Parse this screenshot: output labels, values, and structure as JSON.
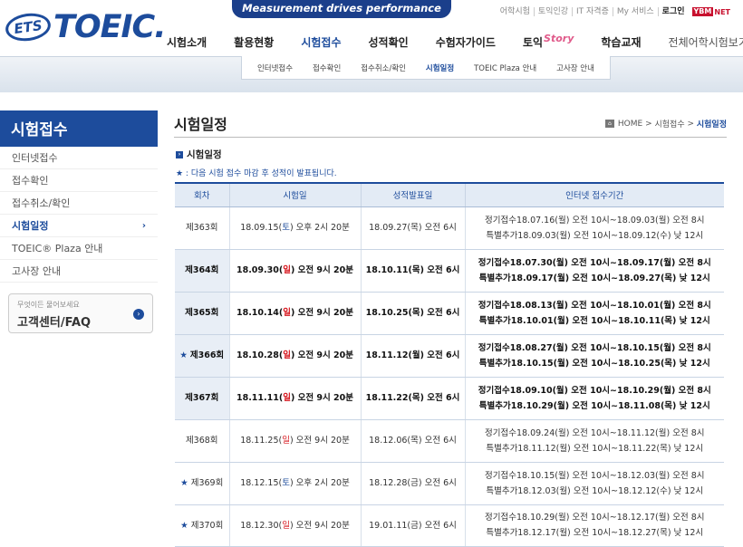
{
  "header": {
    "logo_ets": "ETS",
    "logo_toeic": "TOEIC.",
    "slogan": "Measurement drives performance",
    "util": [
      "어학시험",
      "토익인강",
      "IT 자격증",
      "My 서비스",
      "로그인"
    ],
    "ybm_logo": "YBM",
    "ybm_net": "NET",
    "gnb": [
      "시험소개",
      "활용현황",
      "시험접수",
      "성적확인",
      "수험자가이드",
      "토익",
      "학습교재",
      "전체어학시험보기"
    ],
    "gnb_story": "Story"
  },
  "submenu": [
    "인터넷접수",
    "접수확인",
    "접수취소/확인",
    "시험일정",
    "TOEIC Plaza 안내",
    "고사장 안내"
  ],
  "sidebar": {
    "title": "시험접수",
    "items": [
      "인터넷접수",
      "접수확인",
      "접수취소/확인",
      "시험일정",
      "TOEIC® Plaza 안내",
      "고사장 안내"
    ],
    "chevron": "›",
    "faq_small": "무엇이든 물어보세요",
    "faq_big": "고객센터/FAQ"
  },
  "content": {
    "title": "시험일정",
    "breadcrumb": [
      "HOME",
      "시험접수",
      "시험일정"
    ],
    "section_title": "시험일정",
    "note": "★ : 다음 시험 접수 마감 후 성적이 발표됩니다.",
    "columns": [
      "회차",
      "시험일",
      "성적발표일",
      "인터넷 접수기간"
    ]
  },
  "schedule": [
    {
      "star": false,
      "bold": false,
      "round": "제363회",
      "date_pre": "18.09.15(",
      "day": "토",
      "day_color": "blue",
      "date_post": ") 오후 2시 20분",
      "result": "18.09.27(목) 오전 6시",
      "period1": "정기접수18.07.16(월) 오전 10시~18.09.03(월) 오전 8시",
      "period2": "특별추가18.09.03(월) 오전 10시~18.09.12(수) 낮 12시"
    },
    {
      "star": false,
      "bold": true,
      "round": "제364회",
      "date_pre": "18.09.30(",
      "day": "일",
      "day_color": "red",
      "date_post": ") 오전 9시 20분",
      "result": "18.10.11(목) 오전 6시",
      "period1": "정기접수18.07.30(월) 오전 10시~18.09.17(월) 오전 8시",
      "period2": "특별추가18.09.17(월) 오전 10시~18.09.27(목) 낮 12시"
    },
    {
      "star": false,
      "bold": true,
      "round": "제365회",
      "date_pre": "18.10.14(",
      "day": "일",
      "day_color": "red",
      "date_post": ") 오전 9시 20분",
      "result": "18.10.25(목) 오전 6시",
      "period1": "정기접수18.08.13(월) 오전 10시~18.10.01(월) 오전 8시",
      "period2": "특별추가18.10.01(월) 오전 10시~18.10.11(목) 낮 12시"
    },
    {
      "star": true,
      "bold": true,
      "round": "제366회",
      "date_pre": "18.10.28(",
      "day": "일",
      "day_color": "red",
      "date_post": ") 오전 9시 20분",
      "result": "18.11.12(월) 오전 6시",
      "period1": "정기접수18.08.27(월) 오전 10시~18.10.15(월) 오전 8시",
      "period2": "특별추가18.10.15(월) 오전 10시~18.10.25(목) 낮 12시"
    },
    {
      "star": false,
      "bold": true,
      "round": "제367회",
      "date_pre": "18.11.11(",
      "day": "일",
      "day_color": "red",
      "date_post": ") 오전 9시 20분",
      "result": "18.11.22(목) 오전 6시",
      "period1": "정기접수18.09.10(월) 오전 10시~18.10.29(월) 오전 8시",
      "period2": "특별추가18.10.29(월) 오전 10시~18.11.08(목) 낮 12시"
    },
    {
      "star": false,
      "bold": false,
      "round": "제368회",
      "date_pre": "18.11.25(",
      "day": "일",
      "day_color": "red",
      "date_post": ") 오전 9시 20분",
      "result": "18.12.06(목) 오전 6시",
      "period1": "정기접수18.09.24(월) 오전 10시~18.11.12(월) 오전 8시",
      "period2": "특별추가18.11.12(월) 오전 10시~18.11.22(목) 낮 12시"
    },
    {
      "star": true,
      "bold": false,
      "round": "제369회",
      "date_pre": "18.12.15(",
      "day": "토",
      "day_color": "blue",
      "date_post": ") 오후 2시 20분",
      "result": "18.12.28(금) 오전 6시",
      "period1": "정기접수18.10.15(월) 오전 10시~18.12.03(월) 오전 8시",
      "period2": "특별추가18.12.03(월) 오전 10시~18.12.12(수) 낮 12시"
    },
    {
      "star": true,
      "bold": false,
      "round": "제370회",
      "date_pre": "18.12.30(",
      "day": "일",
      "day_color": "red",
      "date_post": ") 오전 9시 20분",
      "result": "19.01.11(금) 오전 6시",
      "period1": "정기접수18.10.29(월) 오전 10시~18.12.17(월) 오전 8시",
      "period2": "특별추가18.12.17(월) 오전 10시~18.12.27(목) 낮 12시"
    }
  ],
  "colors": {
    "brand": "#1d4c9c",
    "sunday": "#d71920",
    "saturday": "#1d4c9c"
  }
}
